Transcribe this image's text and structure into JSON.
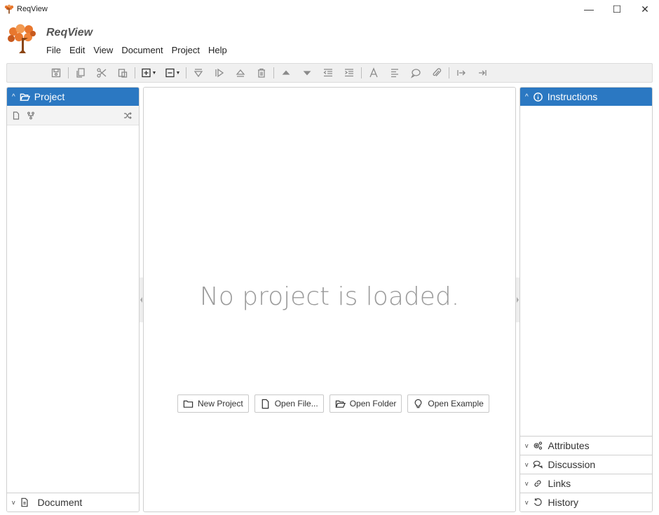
{
  "window": {
    "title": "ReqView",
    "controls": {
      "minimize": "—",
      "maximize": "☐",
      "close": "✕"
    }
  },
  "app": {
    "name": "ReqView"
  },
  "menu": [
    "File",
    "Edit",
    "View",
    "Document",
    "Project",
    "Help"
  ],
  "toolbar": {
    "buttons": [
      {
        "name": "save",
        "icon": "save-icon"
      },
      {
        "name": "copy",
        "icon": "copy-icon"
      },
      {
        "name": "cut",
        "icon": "scissors-icon"
      },
      {
        "name": "paste",
        "icon": "paste-icon"
      },
      {
        "name": "add",
        "icon": "plus-box-icon",
        "dropdown": true
      },
      {
        "name": "remove",
        "icon": "minus-box-icon",
        "dropdown": true
      },
      {
        "name": "filter",
        "icon": "filter-icon"
      },
      {
        "name": "play",
        "icon": "play-icon"
      },
      {
        "name": "eject",
        "icon": "eject-icon"
      },
      {
        "name": "delete",
        "icon": "trash-icon"
      },
      {
        "name": "move-up",
        "icon": "triangle-up-icon"
      },
      {
        "name": "move-down",
        "icon": "triangle-down-icon"
      },
      {
        "name": "outdent",
        "icon": "outdent-icon"
      },
      {
        "name": "indent",
        "icon": "indent-icon"
      },
      {
        "name": "text-format",
        "icon": "font-icon"
      },
      {
        "name": "align",
        "icon": "align-left-icon"
      },
      {
        "name": "comment",
        "icon": "comment-icon"
      },
      {
        "name": "attach",
        "icon": "paperclip-icon"
      },
      {
        "name": "link-to",
        "icon": "arrow-right-bar-icon"
      },
      {
        "name": "link-end",
        "icon": "arrow-to-end-icon"
      }
    ]
  },
  "left_panel": {
    "header": "Project",
    "bottom_section": "Document"
  },
  "center": {
    "message": "No project is loaded.",
    "actions": {
      "new_project": "New Project",
      "open_file": "Open File...",
      "open_folder": "Open Folder",
      "open_example": "Open Example"
    }
  },
  "right_panel": {
    "header": "Instructions",
    "sections": {
      "attributes": "Attributes",
      "discussion": "Discussion",
      "links": "Links",
      "history": "History"
    }
  },
  "colors": {
    "accent": "#2b78c2",
    "logo_orange": "#e8772e",
    "logo_trunk": "#8b4513"
  }
}
